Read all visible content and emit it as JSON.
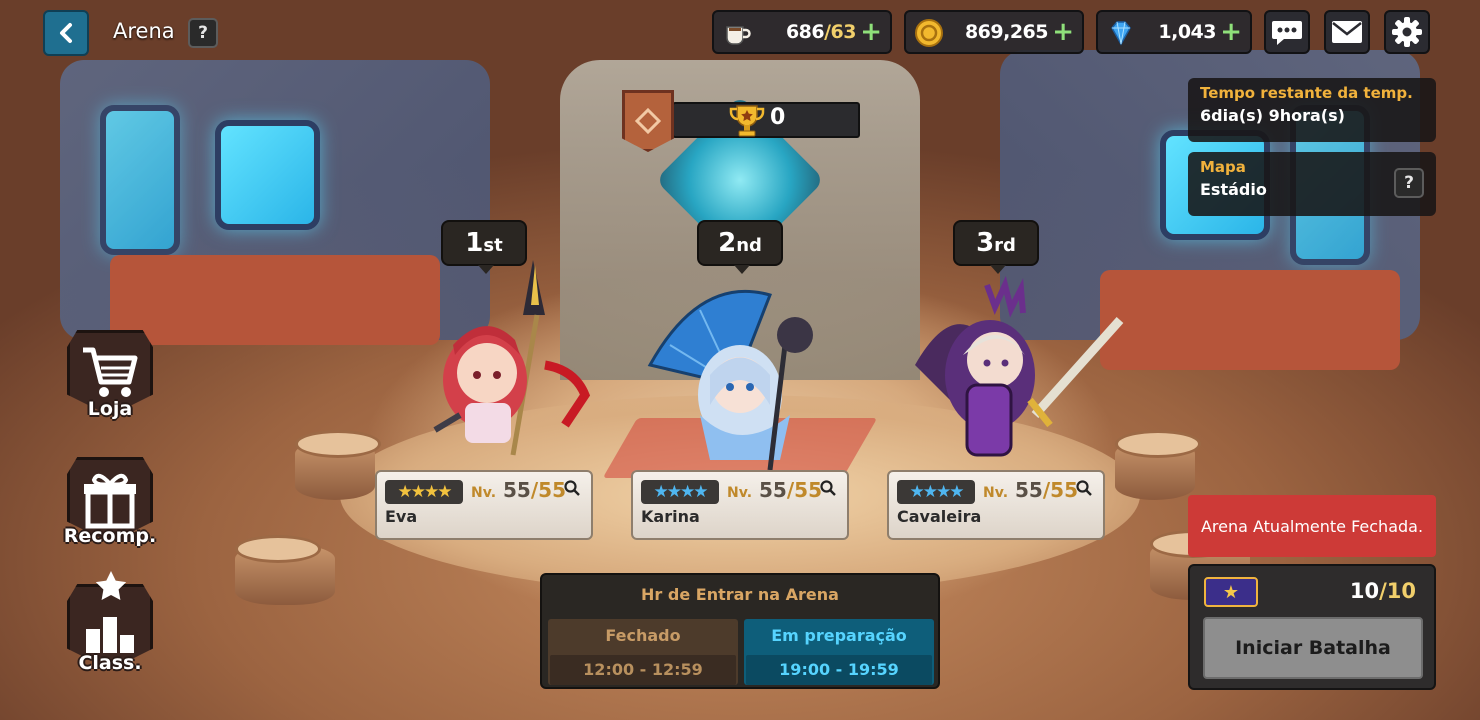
{
  "header": {
    "title": "Arena",
    "help": "?"
  },
  "resources": {
    "stamina": {
      "current": "686",
      "max": "/63",
      "icon": "coffee-cup-icon"
    },
    "gold": {
      "value": "869,265",
      "icon": "gold-coin-icon"
    },
    "gems": {
      "value": "1,043",
      "icon": "gem-icon"
    },
    "plus": "+"
  },
  "top_buttons": [
    "chat-icon",
    "mail-icon",
    "settings-icon"
  ],
  "season": {
    "label": "Tempo restante da temp.",
    "value": "6dia(s) 9hora(s)"
  },
  "map": {
    "label": "Mapa",
    "value": "Estádio",
    "help": "?"
  },
  "trophies": {
    "count": "0"
  },
  "ranking": [
    {
      "num": "1",
      "suffix": "st",
      "name": "Eva",
      "level": "55",
      "max_level": "/55",
      "level_prefix": "Nv."
    },
    {
      "num": "2",
      "suffix": "nd",
      "name": "Karina",
      "level": "55",
      "max_level": "/55",
      "level_prefix": "Nv."
    },
    {
      "num": "3",
      "suffix": "rd",
      "name": "Cavaleira",
      "level": "55",
      "max_level": "/55",
      "level_prefix": "Nv."
    }
  ],
  "side_menu": {
    "shop": "Loja",
    "rewards": "Recomp.",
    "rank": "Class."
  },
  "schedule": {
    "title": "Hr de Entrar na Arena",
    "closed": {
      "label": "Fechado",
      "time": "12:00 - 12:59"
    },
    "prep": {
      "label": "Em preparação",
      "time": "19:00 - 19:59"
    }
  },
  "status": {
    "closed_banner": "Arena Atualmente Fechada."
  },
  "battle": {
    "tickets": "10",
    "tickets_max": "/10",
    "start": "Iniciar Batalha"
  },
  "colors": {
    "accent_gold": "#f1cf6b",
    "label_orange": "#f1b23c",
    "danger": "#cd3a37",
    "prep_blue": "#56d4ff"
  }
}
